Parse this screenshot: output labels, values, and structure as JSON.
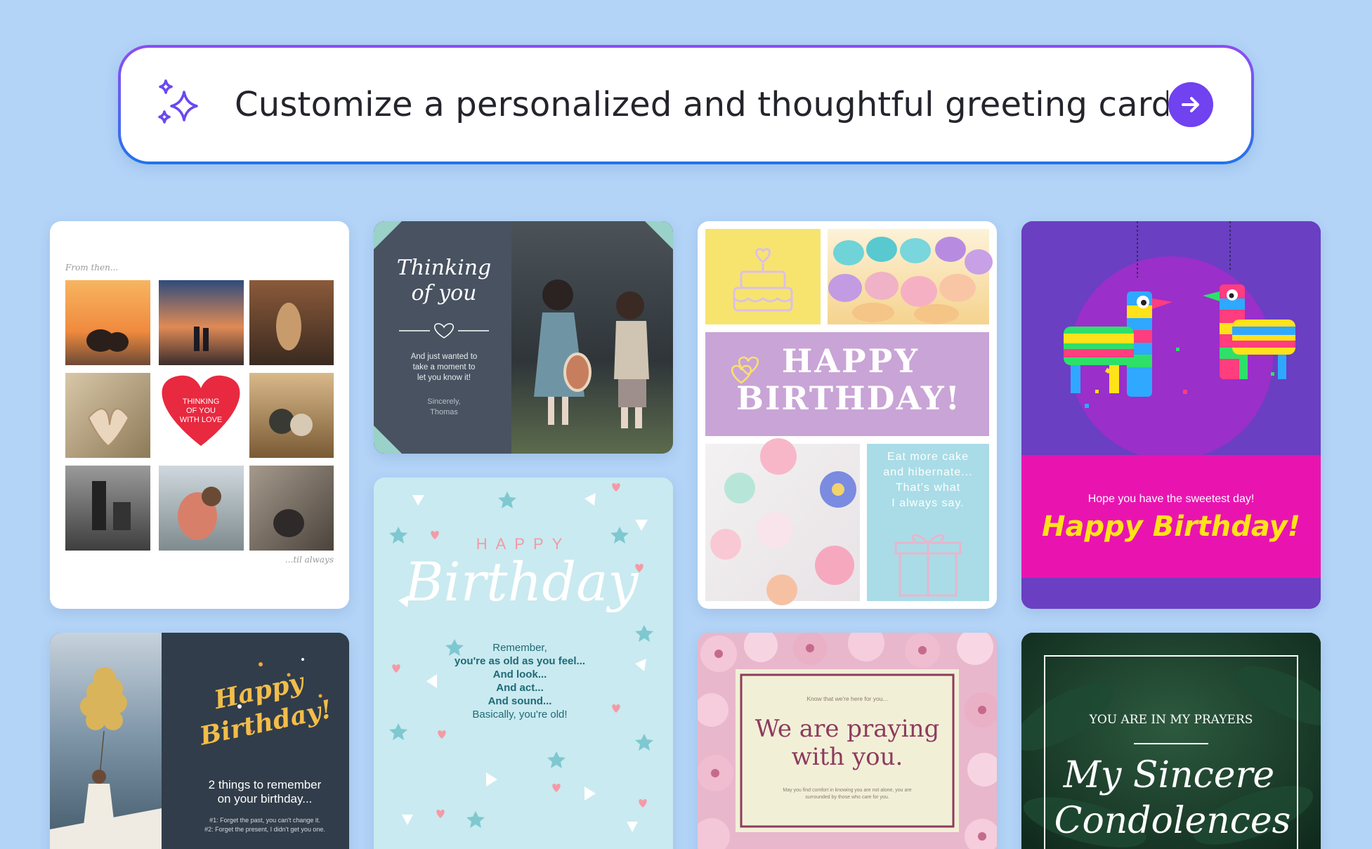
{
  "prompt": {
    "text": "Customize a personalized and thoughtful greeting card...",
    "icon": "sparkle-icon",
    "submit_icon": "arrow-right-icon",
    "accent": "#7042f0"
  },
  "cards": [
    {
      "theme": "photo-collage",
      "top_note": "From then...",
      "heart_text": [
        "THINKING",
        "OF YOU",
        "WITH LOVE"
      ],
      "bottom_note": "...til always",
      "heart_color": "#e8293f"
    },
    {
      "theme": "thinking-of-you",
      "title_line1": "Thinking",
      "title_line2": "of you",
      "message_line1": "And just wanted to",
      "message_line2": "take a moment to",
      "message_line3": "let you know it!",
      "signoff": "Sincerely,",
      "signature": "Thomas"
    },
    {
      "theme": "birthday-cupcakes",
      "headline_line1": "HAPPY",
      "headline_line2": "BIRTHDAY!",
      "quote": [
        "Eat more cake",
        "and hibernate...",
        "That's what",
        "I always say."
      ]
    },
    {
      "theme": "birthday-pinata",
      "subtitle": "Hope you have the sweetest day!",
      "title": "Happy Birthday!",
      "title_color": "#ffe21a",
      "band_color": "#e914b0"
    },
    {
      "theme": "birthday-balloons",
      "title_line1": "Happy",
      "title_line2": "Birthday!",
      "heading_line1": "2 things to remember",
      "heading_line2": "on your birthday...",
      "note1": "#1: Forget the past, you can't change it.",
      "note2": "#2: Forget the present, I didn't get you one."
    },
    {
      "theme": "birthday-confetti",
      "top": "HAPPY",
      "script": "Birthday",
      "lines": [
        "Remember,",
        "you're as old as you feel...",
        "And look...",
        "And act...",
        "And sound...",
        "Basically, you're old!"
      ]
    },
    {
      "theme": "praying-floral",
      "small_top": "Know that we're here for you...",
      "title_line1": "We are praying",
      "title_line2": "with you.",
      "small_bottom_line1": "May you find comfort in knowing you are not alone, you are",
      "small_bottom_line2": "surrounded by those who care for you."
    },
    {
      "theme": "condolences",
      "top": "YOU ARE IN MY PRAYERS",
      "script_line1": "My Sincere",
      "script_line2": "Condolences"
    }
  ]
}
